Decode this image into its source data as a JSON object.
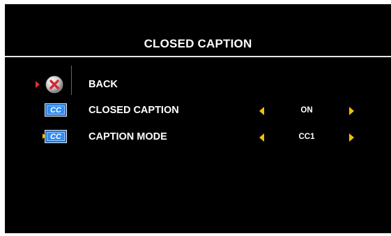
{
  "menu": {
    "title": "CLOSED CAPTION",
    "items": [
      {
        "label": "BACK",
        "icon": "back-icon"
      },
      {
        "label": "CLOSED CAPTION",
        "value": "ON",
        "icon": "cc-icon"
      },
      {
        "label": "CAPTION MODE",
        "value": "CC1",
        "icon": "cc-icon"
      }
    ]
  },
  "icons": {
    "cc_text": "CC"
  },
  "colors": {
    "background": "#000000",
    "text": "#ffffff",
    "arrow": "#f2c200",
    "pointer": "#e0303a",
    "cc_icon": "#1e6fc8"
  }
}
